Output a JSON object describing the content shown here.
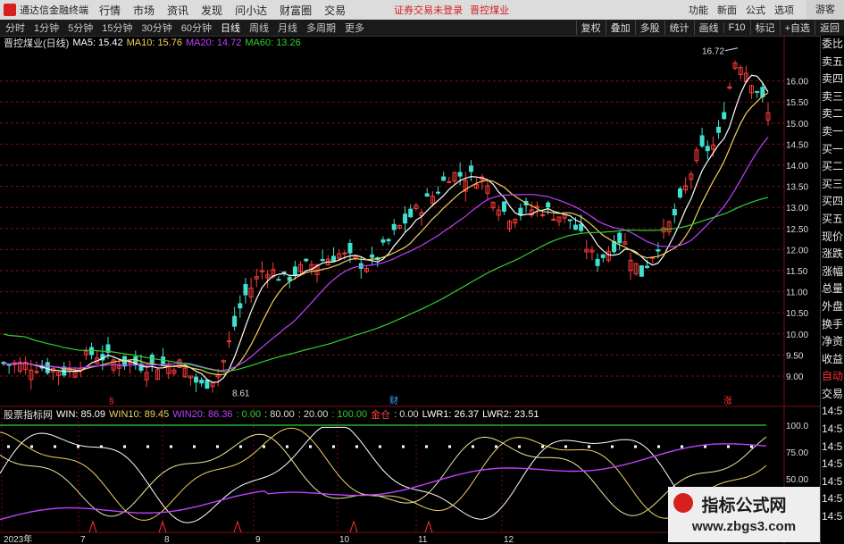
{
  "titlebar": {
    "app_name": "通达信金融终端",
    "menus": [
      "行情",
      "市场",
      "资讯",
      "发现",
      "问小达",
      "财富圈",
      "交易"
    ],
    "warning": "证券交易未登录",
    "stock": "晋控煤业",
    "right_items": [
      "功能",
      "新面",
      "公式",
      "选项"
    ],
    "guest": "游客"
  },
  "toolbar": {
    "periods": [
      "分时",
      "1分钟",
      "5分钟",
      "15分钟",
      "30分钟",
      "60分钟",
      "日线",
      "周线",
      "月线",
      "多周期",
      "更多"
    ],
    "active_period": "日线",
    "right_buttons": [
      "复权",
      "叠加",
      "多股",
      "统计",
      "画线",
      "F10",
      "标记",
      "+自选",
      "返回"
    ]
  },
  "main_header": {
    "stock_title": "晋控煤业(日线)",
    "ma5": "MA5: 15.42",
    "ma10": "MA10: 15.76",
    "ma20": "MA20: 14.72",
    "ma60": "MA60: 13.26"
  },
  "sub_header": {
    "indicator": "股票指标网",
    "win": "WIN: 85.09",
    "win10": "WIN10: 89.45",
    "win20": "WIN20: 86.36",
    "v0": ": 0.00",
    "v80": ": 80.00",
    "v20": ": 20.00",
    "v100": ": 100.00",
    "gold": "金仓",
    "v0b": ": 0.00",
    "lwr1": "LWR1: 26.37",
    "lwr2": "LWR2: 23.51"
  },
  "price_axis": [
    "16.00",
    "15.50",
    "15.00",
    "14.50",
    "14.00",
    "13.50",
    "13.00",
    "12.50",
    "12.00",
    "11.50",
    "11.00",
    "10.50",
    "10.00",
    "9.50",
    "9.00"
  ],
  "sub_axis": [
    "100.0",
    "75.00",
    "50.00"
  ],
  "annotations": {
    "high": "16.72",
    "low": "8.61",
    "marker_left": "§",
    "marker_mid": "财",
    "marker_right": "涨"
  },
  "date_axis": [
    "2023年",
    "7",
    "8",
    "9",
    "10",
    "11",
    "12"
  ],
  "sidebar": [
    {
      "label": "委比",
      "red": false
    },
    {
      "label": "卖五",
      "red": false
    },
    {
      "label": "卖四",
      "red": false
    },
    {
      "label": "卖三",
      "red": false
    },
    {
      "label": "卖二",
      "red": false
    },
    {
      "label": "卖一",
      "red": false
    },
    {
      "label": "买一",
      "red": false
    },
    {
      "label": "买二",
      "red": false
    },
    {
      "label": "买三",
      "red": false
    },
    {
      "label": "买四",
      "red": false
    },
    {
      "label": "买五",
      "red": false
    },
    {
      "label": "现价",
      "red": false
    },
    {
      "label": "涨跌",
      "red": false
    },
    {
      "label": "涨幅",
      "red": false
    },
    {
      "label": "总量",
      "red": false
    },
    {
      "label": "外盘",
      "red": false
    },
    {
      "label": "换手",
      "red": false
    },
    {
      "label": "净资",
      "red": false
    },
    {
      "label": "收益",
      "red": false
    },
    {
      "label": "自动",
      "red": true
    },
    {
      "label": "交易",
      "red": false
    },
    {
      "label": "14:5",
      "red": false
    },
    {
      "label": "14:5",
      "red": false
    },
    {
      "label": "14:5",
      "red": false
    },
    {
      "label": "14:5",
      "red": false
    },
    {
      "label": "14:5",
      "red": false
    },
    {
      "label": "14:5",
      "red": false
    },
    {
      "label": "14:5",
      "red": false
    }
  ],
  "watermark": {
    "line1": "指标公式网",
    "line2": "www.zbgs3.com"
  },
  "colors": {
    "up": "#ff3b3b",
    "down": "#40e0d0",
    "ma5": "#ffffff",
    "ma10": "#f0d060",
    "ma20": "#c040ff",
    "ma60": "#30d030"
  }
}
